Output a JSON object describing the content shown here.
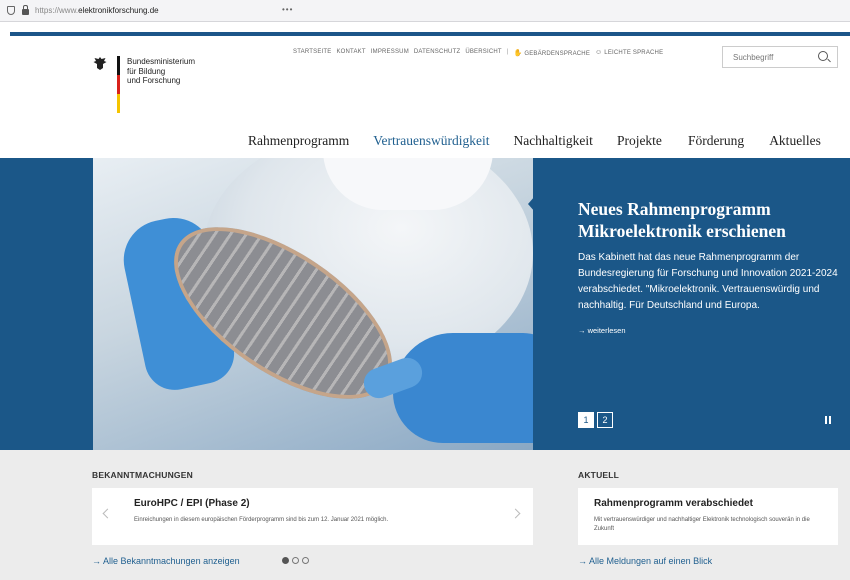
{
  "browser": {
    "url_prefix": "https://www.",
    "url_domain": "elektronikforschung.de",
    "menu": "•••"
  },
  "logo": {
    "line1": "Bundesministerium",
    "line2": "für Bildung",
    "line3": "und Forschung"
  },
  "service_nav": {
    "items": [
      "STARTSEITE",
      "KONTAKT",
      "IMPRESSUM",
      "DATENSCHUTZ",
      "ÜBERSICHT"
    ],
    "separator": "|",
    "sign_language": "GEBÄRDENSPRACHE",
    "easy_language": "LEICHTE SPRACHE"
  },
  "search": {
    "placeholder": "Suchbegriff"
  },
  "main_nav": {
    "items": [
      "Rahmenprogramm",
      "Vertrauenswürdigkeit",
      "Nachhaltigkeit",
      "Projekte",
      "Förderung",
      "Aktuelles"
    ],
    "active": "Vertrauenswürdigkeit"
  },
  "hero": {
    "title": "Neues Rahmenprogramm Mikroelektronik erschienen",
    "text": "Das Kabinett hat das neue Rahmenprogramm der Bundesregierung für Forschung und Innovation 2021-2024 verabschiedet. \"Mikroelektronik. Vertrauenswürdig und nachhaltig. Für Deutschland und Europa.",
    "more": "→ weiterlesen",
    "pages": [
      "1",
      "2"
    ],
    "current_page": 1
  },
  "announcements": {
    "title": "BEKANNTMACHUNGEN",
    "card_title": "EuroHPC / EPI (Phase 2)",
    "card_text": "Einreichungen in diesem europäischen Förderprogramm sind bis zum 12. Januar 2021 möglich.",
    "all_link": "→  Alle Bekanntmachungen anzeigen",
    "dots": 3,
    "active_dot": 1
  },
  "news": {
    "title": "AKTUELL",
    "card_title": "Rahmenprogramm verabschiedet",
    "card_text": "Mit vertrauenswürdiger und nachhaltiger Elektronik technologisch souverän in die Zukunft",
    "all_link": "→  Alle Meldungen auf einen Blick"
  },
  "colors": {
    "brand_blue": "#1b5788",
    "link_blue": "#1f5f8f",
    "flag_black": "#111111",
    "flag_red": "#d9221b",
    "flag_gold": "#f5c400"
  },
  "icons": {
    "eagle": "eagle-icon",
    "search": "search-icon",
    "pause": "pause-icon"
  }
}
